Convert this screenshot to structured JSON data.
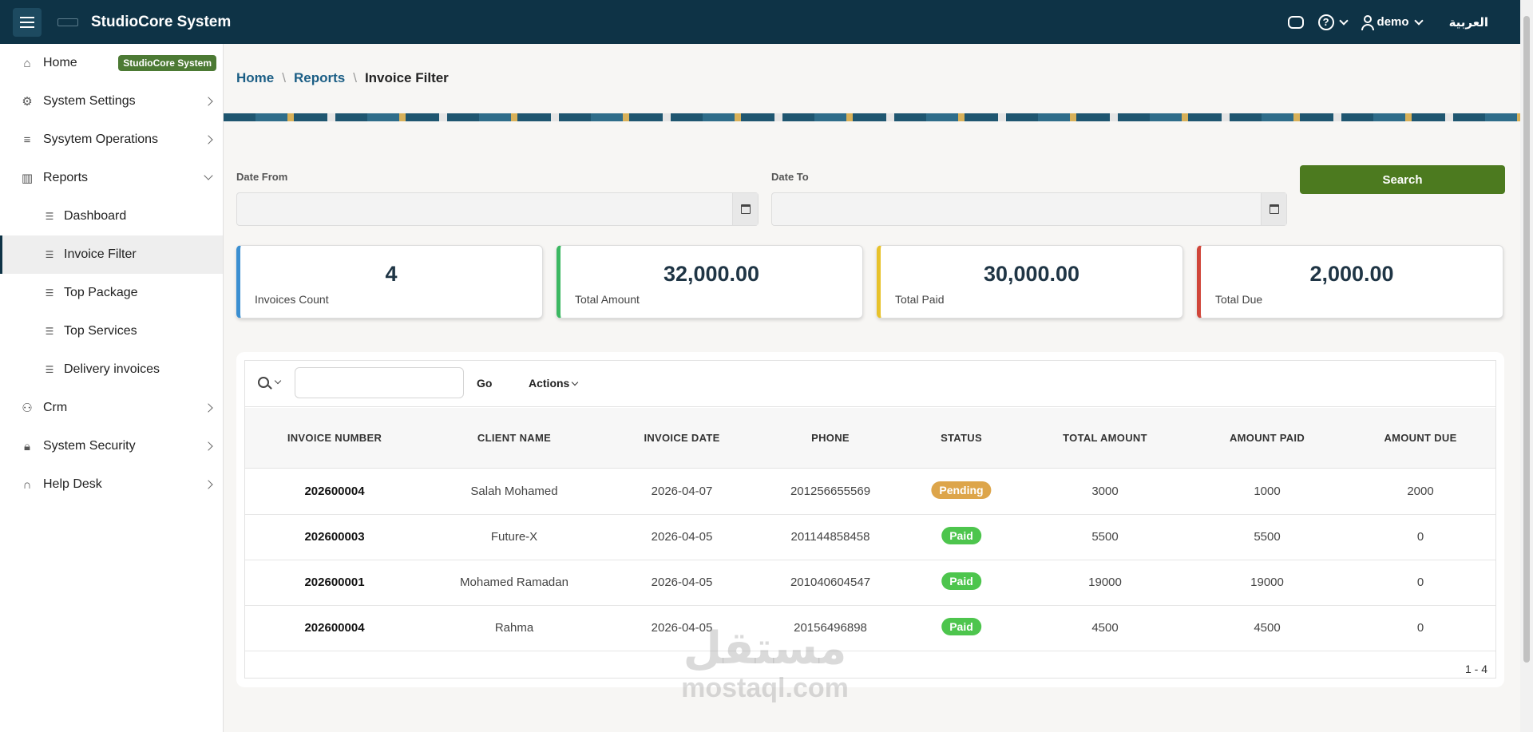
{
  "topbar": {
    "app_title": "StudioCore System",
    "user_name": "demo",
    "language": "العربية",
    "help_glyph": "?",
    "icons": [
      "menu-icon",
      "chat-icon",
      "help-icon",
      "user-icon"
    ]
  },
  "sidebar": {
    "home_badge": "StudioCore System",
    "items": [
      {
        "label": "Home",
        "icon": "home-icon"
      },
      {
        "label": "System Settings",
        "icon": "gear-icon"
      },
      {
        "label": "Sysytem Operations",
        "icon": "database-icon"
      },
      {
        "label": "Reports",
        "icon": "chart-icon"
      },
      {
        "label": "Dashboard",
        "icon": "list-icon"
      },
      {
        "label": "Invoice Filter",
        "icon": "list-icon"
      },
      {
        "label": "Top Package",
        "icon": "list-icon"
      },
      {
        "label": "Top Services",
        "icon": "list-icon"
      },
      {
        "label": "Delivery invoices",
        "icon": "list-icon"
      },
      {
        "label": "Crm",
        "icon": "users-icon"
      },
      {
        "label": "System Security",
        "icon": "lock-icon"
      },
      {
        "label": "Help Desk",
        "icon": "headset-icon"
      }
    ]
  },
  "breadcrumb": {
    "home": "Home",
    "reports": "Reports",
    "current": "Invoice Filter",
    "separator": "\\"
  },
  "filters": {
    "date_from_label": "Date From",
    "date_from_value": "",
    "date_to_label": "Date To",
    "date_to_value": "",
    "search_label": "Search"
  },
  "stats": [
    {
      "value": "4",
      "label": "Invoices Count",
      "color": "#3b8fd1"
    },
    {
      "value": "32,000.00",
      "label": "Total Amount",
      "color": "#3cb862"
    },
    {
      "value": "30,000.00",
      "label": "Total Paid",
      "color": "#e8c22b"
    },
    {
      "value": "2,000.00",
      "label": "Total Due",
      "color": "#d0463a"
    }
  ],
  "report": {
    "search_value": "",
    "go_label": "Go",
    "actions_label": "Actions",
    "columns": [
      "INVOICE NUMBER",
      "CLIENT NAME",
      "INVOICE DATE",
      "PHONE",
      "STATUS",
      "TOTAL AMOUNT",
      "AMOUNT PAID",
      "AMOUNT DUE"
    ],
    "rows": [
      {
        "invoice": "202600004",
        "client": "Salah Mohamed",
        "date": "2026-04-07",
        "phone": "201256655569",
        "status": "Pending",
        "total": "3000",
        "paid": "1000",
        "due": "2000"
      },
      {
        "invoice": "202600003",
        "client": "Future-X",
        "date": "2026-04-05",
        "phone": "201144858458",
        "status": "Paid",
        "total": "5500",
        "paid": "5500",
        "due": "0"
      },
      {
        "invoice": "202600001",
        "client": "Mohamed Ramadan",
        "date": "2026-04-05",
        "phone": "201040604547",
        "status": "Paid",
        "total": "19000",
        "paid": "19000",
        "due": "0"
      },
      {
        "invoice": "202600004",
        "client": "Rahma",
        "date": "2026-04-05",
        "phone": "20156496898",
        "status": "Paid",
        "total": "4500",
        "paid": "4500",
        "due": "0"
      }
    ],
    "pagination": "1 - 4"
  },
  "watermark": {
    "arabic": "مستقل",
    "latin": "mostaql.com"
  },
  "colors": {
    "topbar": "#0e3346",
    "accent_link": "#1b5e85",
    "search_button": "#4c7a1f",
    "badge_home": "#4c7a34",
    "status_pending": "#dda54a",
    "status_paid": "#4dc54d"
  }
}
